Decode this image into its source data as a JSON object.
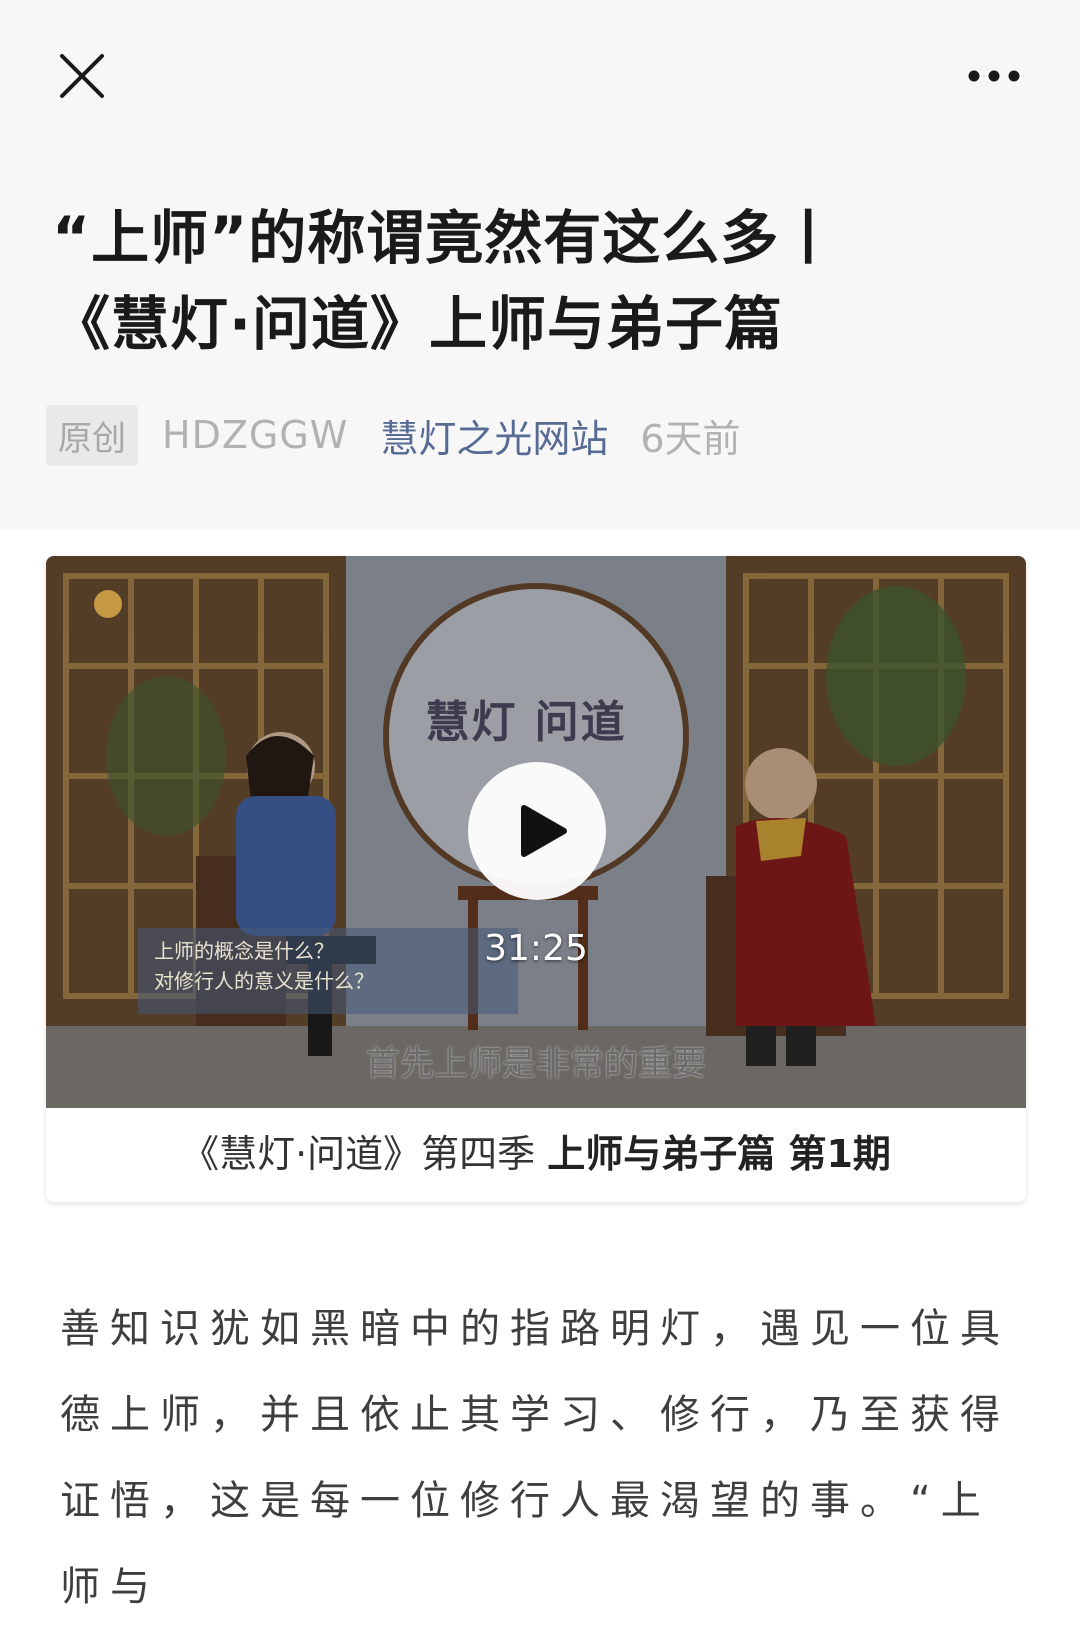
{
  "topbar": {
    "close_icon": "close-icon",
    "more_icon": "more-horizontal-icon"
  },
  "article": {
    "title_line1": "“上师”的称谓竟然有这么多丨",
    "title_line2": "《慧灯·问道》上师与弟子篇",
    "original_badge": "原创",
    "author": "HDZGGW",
    "account_name": "慧灯之光网站",
    "time": "6天前",
    "body_text": "善知识犹如黑暗中的指路明灯，遇见一位具德上师，并且依止其学习、修行，乃至获得证悟，这是每一位修行人最渴望的事。“上师与"
  },
  "video": {
    "show_logo": "慧灯 问道",
    "caption_line1": "上师的概念是什么？",
    "caption_line2": "对修行人的意义是什么？",
    "duration": "31:25",
    "subtitle": "首先上师是非常的重要",
    "title_plain": "《慧灯·问道》第四季 ",
    "title_bold": "上师与弟子篇 第1期",
    "play_icon": "play-icon"
  },
  "colors": {
    "link": "#576b95",
    "meta_gray": "#b2b2b2",
    "header_bg": "#f7f7f7"
  }
}
